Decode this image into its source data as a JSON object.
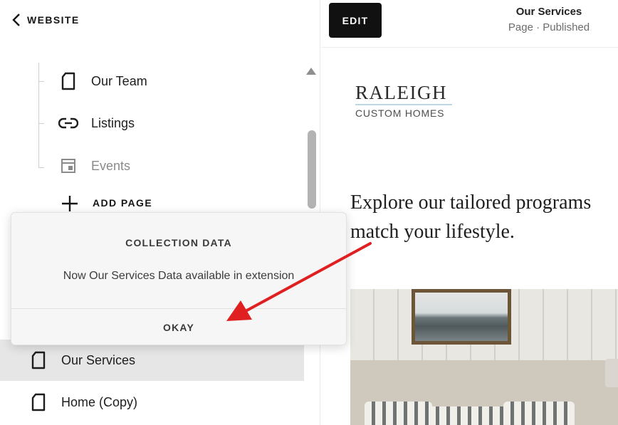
{
  "sidebar": {
    "back_label": "WEBSITE",
    "tree_items": [
      {
        "label": "Our Team",
        "icon": "page-icon"
      },
      {
        "label": "Listings",
        "icon": "link-icon"
      },
      {
        "label": "Events",
        "icon": "events-icon"
      }
    ],
    "add_page_label": "ADD PAGE",
    "nav_items": [
      {
        "label": "Our Services",
        "icon": "page-icon",
        "active": true
      },
      {
        "label": "Home (Copy)",
        "icon": "page-icon",
        "active": false
      }
    ]
  },
  "popup": {
    "title": "COLLECTION DATA",
    "message": "Now Our Services Data available in extension",
    "okay_label": "OKAY"
  },
  "preview": {
    "edit_label": "EDIT",
    "page_title": "Our Services",
    "page_status": "Page · Published",
    "logo_top": "RALEIGH",
    "logo_bottom": "CUSTOM HOMES",
    "headline_line1": "Explore our tailored programs",
    "headline_line2": "match your lifestyle."
  },
  "colors": {
    "active_row": "#e6e6e6",
    "edit_button": "#111111",
    "annotation_arrow": "#e02020",
    "logo_accent": "#bcd6e2"
  }
}
